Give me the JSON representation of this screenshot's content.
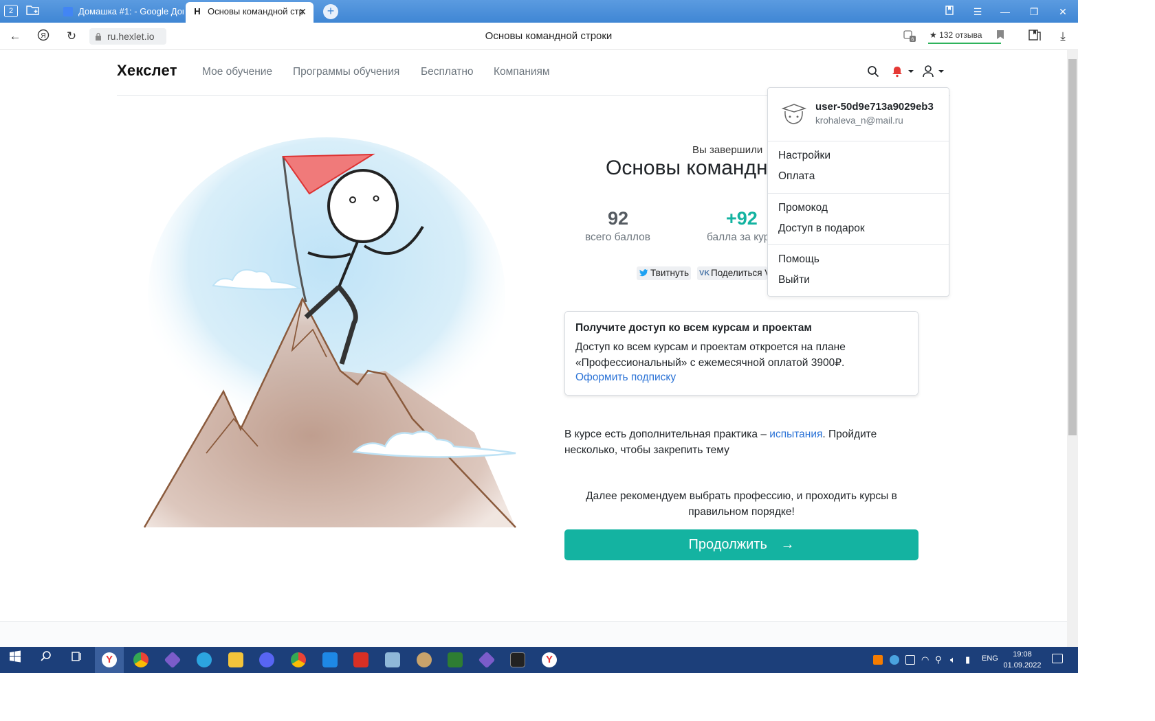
{
  "browser": {
    "tab_counter": "2",
    "tabs": [
      {
        "label": "Домашка #1: - Google Док",
        "active": false
      },
      {
        "label": "Основы командной стр",
        "active": true
      }
    ],
    "new_tab_symbol": "+",
    "address": "ru.hexlet.io",
    "page_title": "Основы командной строки",
    "reviews": "★ 132 отзыва",
    "extension_badge": "6"
  },
  "site": {
    "logo": "Хекслет",
    "nav": [
      "Мое обучение",
      "Программы обучения",
      "Бесплатно",
      "Компаниям"
    ]
  },
  "user_menu": {
    "username": "user-50d9e713a9029eb3",
    "email": "krohaleva_n@mail.ru",
    "groups": [
      [
        "Настройки",
        "Оплата"
      ],
      [
        "Промокод",
        "Доступ в подарок"
      ],
      [
        "Помощь",
        "Выйти"
      ]
    ]
  },
  "main": {
    "completed_text": "Вы завершили",
    "course_title": "Основы командной строки",
    "stats": [
      {
        "value": "92",
        "label": "всего баллов"
      },
      {
        "value": "+92",
        "label": "балла за курс"
      }
    ],
    "share": {
      "tweet": "Твитнуть",
      "vk": "Поделиться VK"
    },
    "promo": {
      "title": "Получите доступ ко всем курсам и проектам",
      "text": "Доступ ко всем курсам и проектам откроется на плане «Профессиональный» с ежемесячной оплатой 3900₽.",
      "link": "Оформить подписку"
    },
    "practice": {
      "before": "В курсе есть дополнительная практика – ",
      "link": "испытания",
      "after": ". Пройдите несколько, чтобы закрепить тему"
    },
    "recommend": "Далее рекомендуем выбрать профессию, и проходить курсы в правильном порядке!",
    "continue_label": "Продолжить",
    "continue_arrow": "→"
  },
  "taskbar": {
    "lang": "ENG",
    "time": "19:08",
    "date": "01.09.2022"
  },
  "colors": {
    "accent": "#14b3a1",
    "link": "#2a72d6",
    "notification": "#e53935",
    "taskbar": "#1c3f7a"
  }
}
